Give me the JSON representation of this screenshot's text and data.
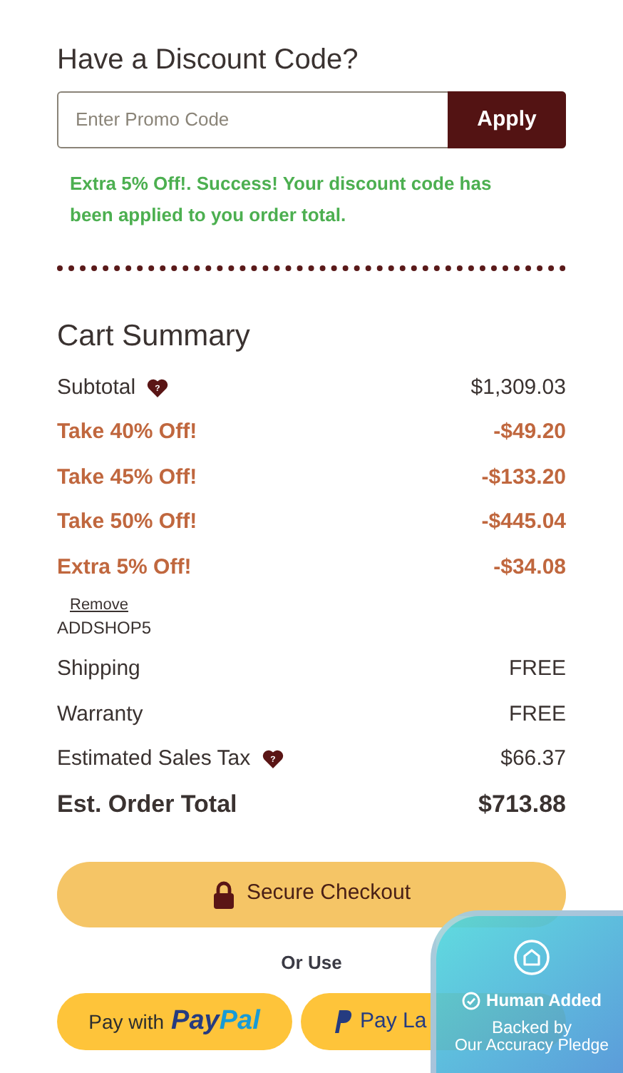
{
  "discount": {
    "title": "Have a Discount Code?",
    "placeholder": "Enter Promo Code",
    "button": "Apply",
    "message": "Extra 5% Off!. Success! Your discount code has been applied to you order total."
  },
  "cart_summary": {
    "title": "Cart Summary",
    "rows": [
      {
        "kind": "normal",
        "label": "Subtotal",
        "value": "$1,309.03",
        "info_icon": "?"
      },
      {
        "kind": "discount",
        "label": "Take 40% Off!",
        "value": "-$49.20"
      },
      {
        "kind": "discount",
        "label": "Take 45% Off!",
        "value": "-$133.20"
      },
      {
        "kind": "discount",
        "label": "Take 50% Off!",
        "value": "-$445.04"
      },
      {
        "kind": "discount",
        "label": "Extra 5% Off!",
        "value": "-$34.08",
        "remove": "Remove",
        "code": "ADDSHOP5"
      },
      {
        "kind": "normal",
        "label": "Shipping",
        "value": "FREE"
      },
      {
        "kind": "normal",
        "label": "Warranty",
        "value": "FREE"
      },
      {
        "kind": "normal",
        "label": "Estimated Sales Tax",
        "value": "$66.37",
        "info_icon": "?"
      },
      {
        "kind": "total",
        "label": "Est. Order Total",
        "value": "$713.88"
      }
    ]
  },
  "checkout": {
    "button": "Secure Checkout",
    "or_use": "Or Use",
    "paypal": {
      "prefix": "Pay with",
      "brand_pay": "Pay",
      "brand_pal": "Pal"
    },
    "pay_later": "Pay La"
  },
  "badge": {
    "title": "Human Added",
    "line_1": "Backed by",
    "line_2": "Our Accuracy Pledge"
  }
}
